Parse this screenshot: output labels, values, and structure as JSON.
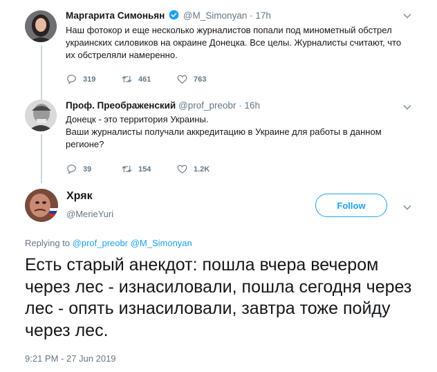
{
  "tweets": [
    {
      "name": "Маргарита Симоньян",
      "handle": "@M_Simonyan",
      "time": "17h",
      "text": "Наш фотокор и еще несколько журналистов попали под минометный обстрел украинских силовиков на окраине Донецка. Все целы. Журналисты считают, что их обстреляли намеренно.",
      "replies": "319",
      "retweets": "461",
      "likes": "763"
    },
    {
      "name": "Проф. Преображенский",
      "handle": "@prof_preobr",
      "time": "16h",
      "text": "Донецк - это территория Украины.\nВаши журналисты получали аккредитацию в Украине для работы в данном регионе?",
      "replies": "39",
      "retweets": "154",
      "likes": "1.2K"
    }
  ],
  "main": {
    "name": "Хряк",
    "handle": "@MerieYuri",
    "follow_label": "Follow",
    "replying_prefix": "Replying to",
    "mention1": "@prof_preobr",
    "mention2": "@M_Simonyan",
    "text": "Есть старый анекдот: пошла вчера вечером через лес - изнасиловали, пошла сегодня через лес - опять изнасиловали, завтра тоже пойду через лес.",
    "timestamp": "9:21 PM - 27 Jun 2019"
  },
  "colors": {
    "accent": "#1da1f2",
    "muted": "#657786",
    "text": "#14171a",
    "thread_line": "#ccd6dd"
  },
  "icons": [
    "verified-icon",
    "reply-icon",
    "retweet-icon",
    "like-icon",
    "chevron-down-icon"
  ]
}
